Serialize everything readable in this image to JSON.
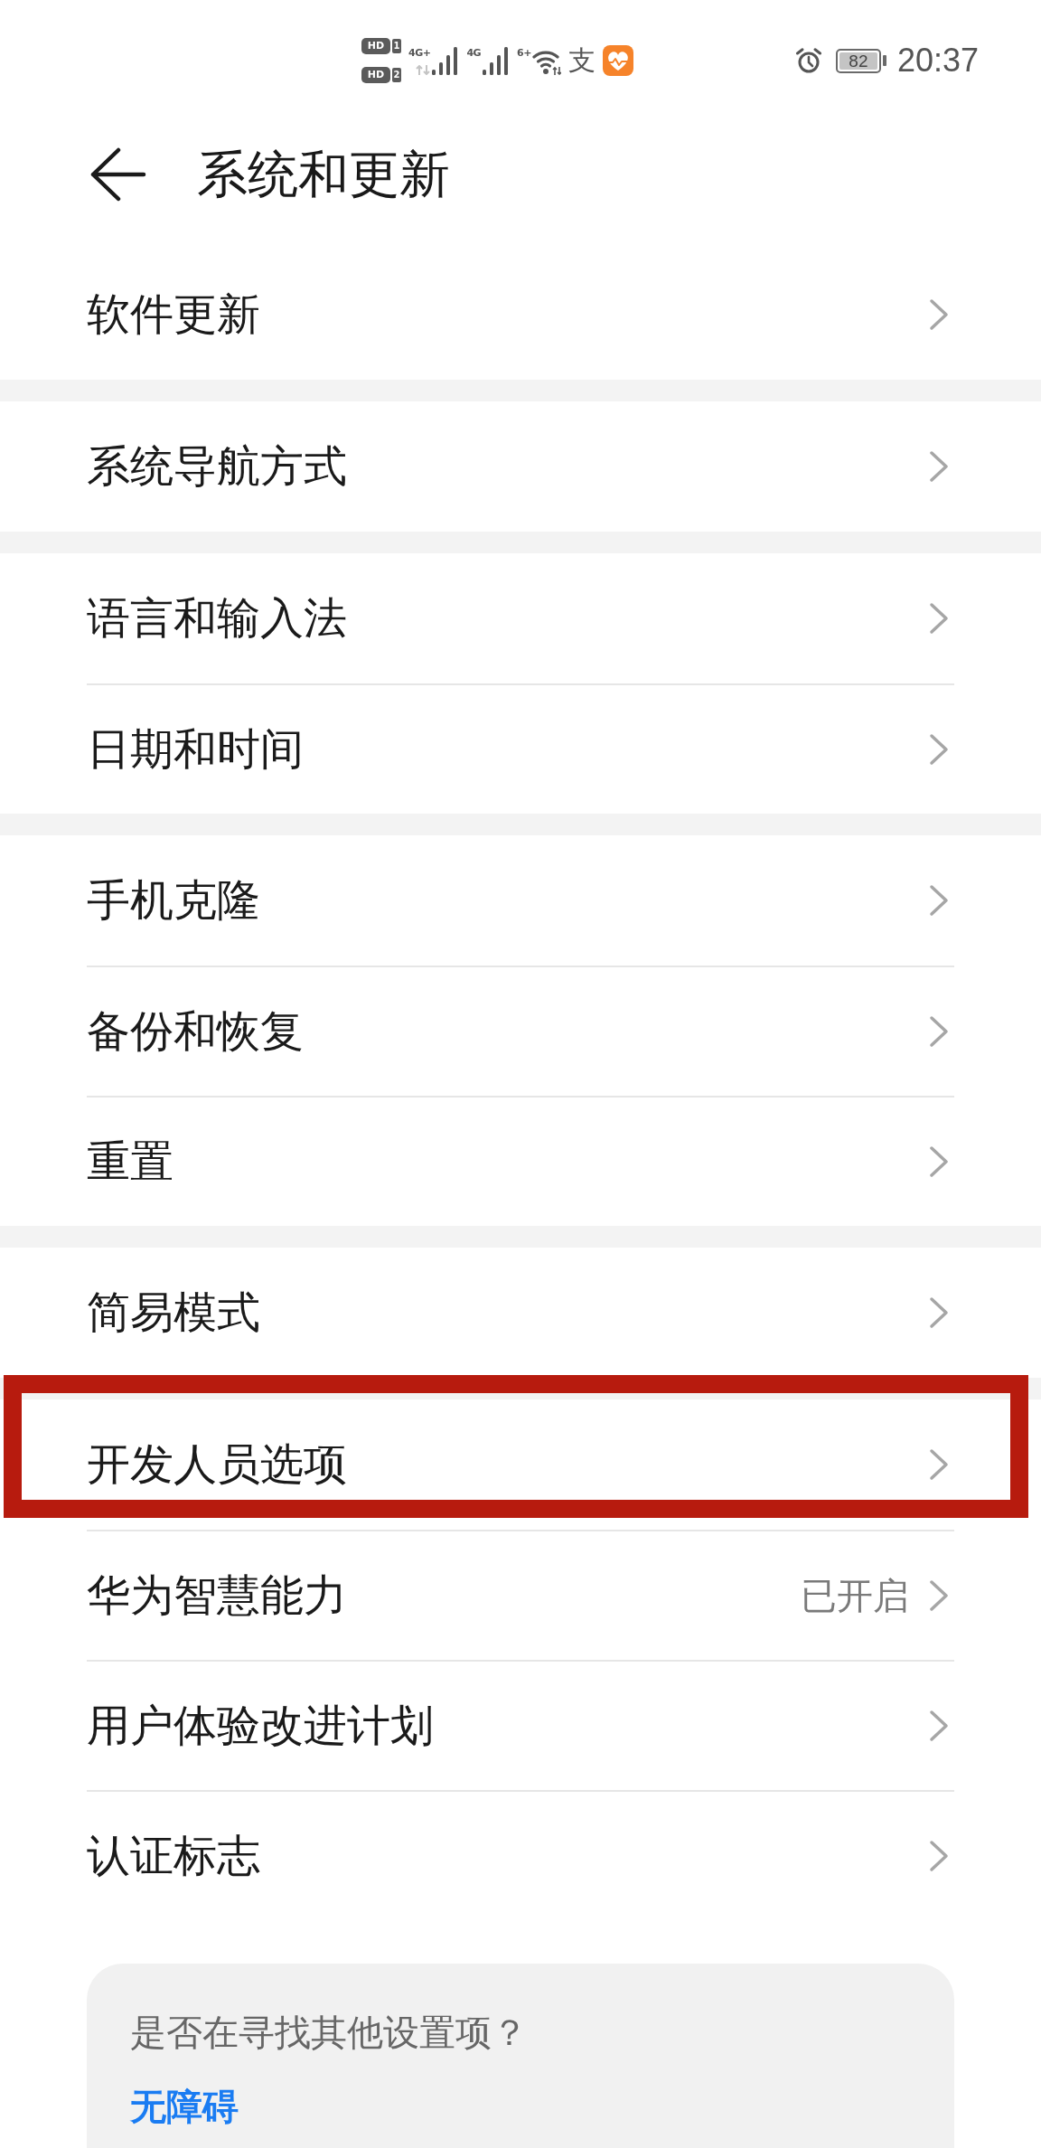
{
  "status_bar": {
    "sim_badges": [
      {
        "label": "HD",
        "slot": "1"
      },
      {
        "label": "HD",
        "slot": "2"
      }
    ],
    "mobile_networks": [
      {
        "label": "4G+",
        "activity": true
      },
      {
        "label": "4G",
        "activity": false
      }
    ],
    "wifi_label": "6+",
    "notification_glyph": "支",
    "battery": "82",
    "time": "20:37"
  },
  "header": {
    "title": "系统和更新"
  },
  "groups": [
    {
      "items": [
        {
          "label": "软件更新",
          "highlighted": false
        }
      ]
    },
    {
      "items": [
        {
          "label": "系统导航方式",
          "highlighted": false
        }
      ]
    },
    {
      "items": [
        {
          "label": "语言和输入法",
          "highlighted": false
        },
        {
          "label": "日期和时间",
          "highlighted": false
        }
      ]
    },
    {
      "items": [
        {
          "label": "手机克隆",
          "highlighted": false
        },
        {
          "label": "备份和恢复",
          "highlighted": false
        },
        {
          "label": "重置",
          "highlighted": false
        }
      ]
    },
    {
      "items": [
        {
          "label": "简易模式",
          "highlighted": false
        }
      ]
    },
    {
      "items": [
        {
          "label": "开发人员选项",
          "highlighted": true
        },
        {
          "label": "华为智慧能力",
          "value": "已开启",
          "highlighted": false
        },
        {
          "label": "用户体验改进计划",
          "highlighted": false
        },
        {
          "label": "认证标志",
          "highlighted": false
        }
      ]
    }
  ],
  "footer_card": {
    "prompt": "是否在寻找其他设置项？",
    "link": "无障碍"
  }
}
